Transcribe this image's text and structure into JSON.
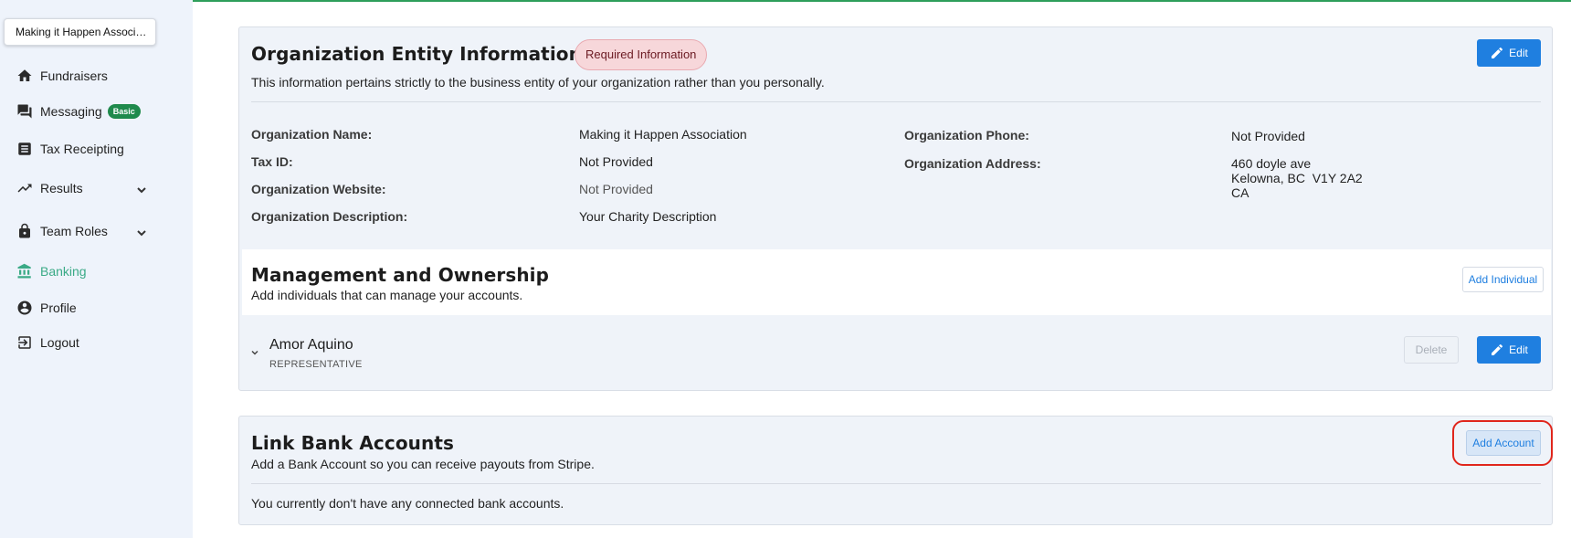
{
  "sidebar": {
    "org_selector": "Making it Happen Associ…",
    "items": [
      {
        "label": "Fundraisers",
        "icon": "home-icon"
      },
      {
        "label": "Messaging",
        "icon": "forum-icon",
        "badge": "Basic"
      },
      {
        "label": "Tax Receipting",
        "icon": "receipt-icon"
      },
      {
        "label": "Results",
        "icon": "trending-up-icon"
      },
      {
        "label": "Team Roles",
        "icon": "lock-icon"
      },
      {
        "label": "Banking",
        "icon": "bank-icon",
        "active": true
      },
      {
        "label": "Profile",
        "icon": "account-circle-icon"
      },
      {
        "label": "Logout",
        "icon": "logout-icon"
      }
    ]
  },
  "entity": {
    "title": "Organization Entity Information",
    "required_badge": "Required Information",
    "edit_label": "Edit",
    "description": "This information pertains strictly to the business entity of your organization rather than you personally.",
    "fields_left": [
      {
        "label": "Organization Name:",
        "value": "Making it Happen Association"
      },
      {
        "label": "Tax ID:",
        "value": "Not Provided"
      },
      {
        "label": "Organization Website:",
        "value": "Not Provided"
      },
      {
        "label": "Organization Description:",
        "value": "Your Charity Description"
      }
    ],
    "phone": {
      "label": "Organization Phone:",
      "value": "Not Provided"
    },
    "address": {
      "label": "Organization Address:",
      "line1": "460 doyle ave",
      "line2": "Kelowna, BC  V1Y 2A2",
      "line3": "CA"
    }
  },
  "management": {
    "title": "Management and Ownership",
    "description": "Add individuals that can manage your accounts.",
    "add_label": "Add Individual",
    "person": {
      "name": "Amor Aquino",
      "role": "REPRESENTATIVE"
    },
    "delete_label": "Delete",
    "edit_label": "Edit"
  },
  "bank": {
    "title": "Link Bank Accounts",
    "description": "Add a Bank Account so you can receive payouts from Stripe.",
    "add_label": "Add Account",
    "empty_message": "You currently don't have any connected bank accounts."
  },
  "colors": {
    "accent": "#1f7fe0",
    "active_nav": "#3aaa86",
    "highlight": "#e0261c",
    "sidebar_bg": "#eef3fb"
  }
}
